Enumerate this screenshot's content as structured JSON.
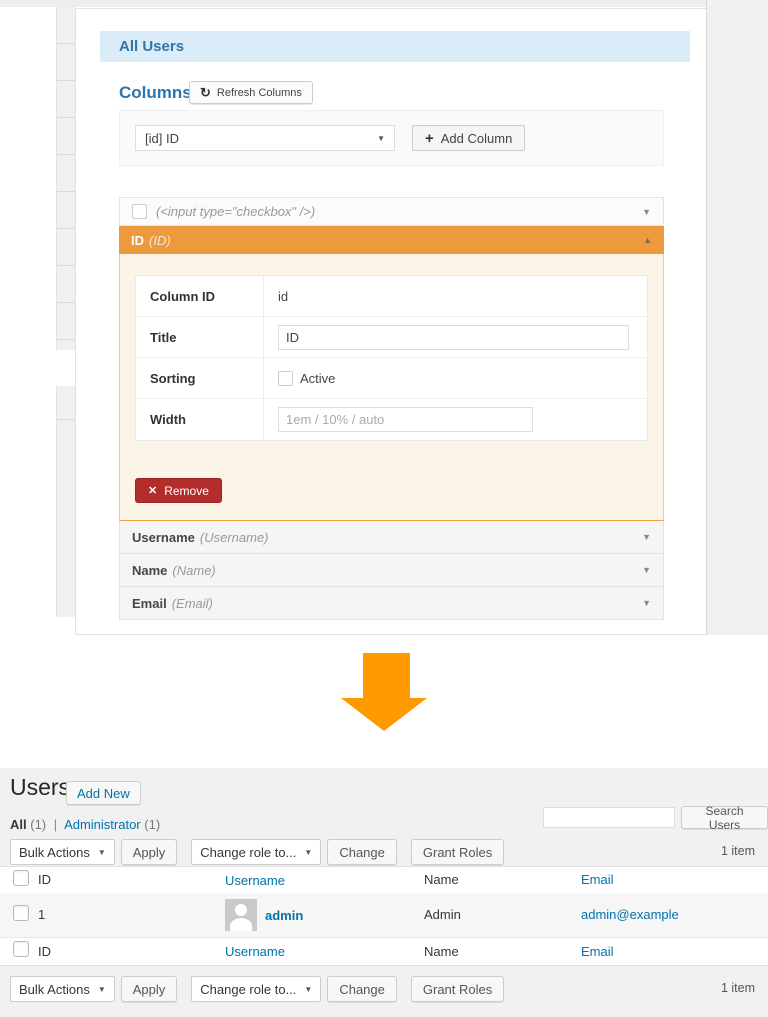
{
  "icons": {
    "caret_down": "▼",
    "caret_up": "▲",
    "select_caret": "▼",
    "refresh": "↻",
    "plus": "+",
    "remove_x": "✕"
  },
  "colors": {
    "accent_orange": "#EC9A3D",
    "arrow_orange": "#FF9900",
    "link_blue": "#0073AA",
    "heading_blue": "#2C74AD",
    "info_bar_bg": "#D9ECF8",
    "remove_red": "#B32D2D"
  },
  "settings_panel": {
    "title": "All Users",
    "columns_heading": "Columns",
    "refresh_button": "Refresh Columns",
    "column_select_value": "[id] ID",
    "add_column_button": "Add Column",
    "checkbox_item_label": "(<input type=\"checkbox\" />)",
    "expanded_item": {
      "label": "ID",
      "type": "(ID)",
      "fields": [
        {
          "label": "Column ID",
          "value": "id"
        },
        {
          "label": "Title",
          "value": "ID"
        },
        {
          "label": "Sorting",
          "value": "Active"
        },
        {
          "label": "Width",
          "placeholder": "1em / 10% / auto"
        }
      ],
      "remove_button": "Remove"
    },
    "collapsed_items": [
      {
        "label": "Username",
        "type": "(Username)"
      },
      {
        "label": "Name",
        "type": "(Name)"
      },
      {
        "label": "Email",
        "type": "(Email)"
      }
    ]
  },
  "users_page": {
    "title": "Users",
    "add_new_button": "Add New",
    "filter_links": {
      "all_label": "All",
      "all_count": "(1)",
      "separator": "|",
      "role_label": "Administrator",
      "role_count": "(1)"
    },
    "search": {
      "input_value": "",
      "button": "Search Users"
    },
    "toolbar": {
      "bulk_actions": "Bulk Actions",
      "apply": "Apply",
      "change_role": "Change role to...",
      "change": "Change",
      "grant_roles": "Grant Roles",
      "item_count": "1 item"
    },
    "table": {
      "headers": [
        "ID",
        "Username",
        "Name",
        "Email"
      ],
      "row": {
        "id": "1",
        "username": "admin",
        "name": "Admin",
        "email": "admin@example"
      }
    }
  }
}
